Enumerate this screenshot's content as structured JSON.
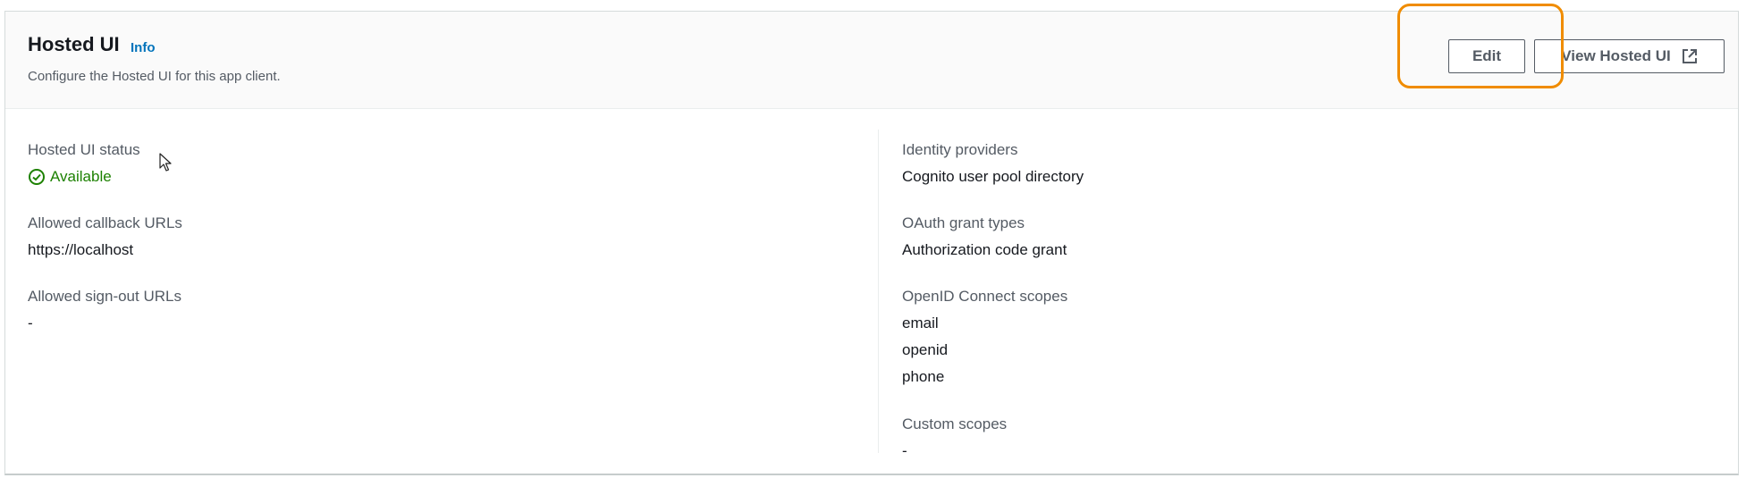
{
  "header": {
    "title": "Hosted UI",
    "info_label": "Info",
    "description": "Configure the Hosted UI for this app client."
  },
  "actions": {
    "edit_label": "Edit",
    "view_label": "View Hosted UI"
  },
  "left_column": {
    "status": {
      "label": "Hosted UI status",
      "value": "Available"
    },
    "callback_urls": {
      "label": "Allowed callback URLs",
      "value": "https://localhost"
    },
    "signout_urls": {
      "label": "Allowed sign-out URLs",
      "value": "-"
    }
  },
  "right_column": {
    "identity_providers": {
      "label": "Identity providers",
      "value": "Cognito user pool directory"
    },
    "grant_types": {
      "label": "OAuth grant types",
      "value": "Authorization code grant"
    },
    "oidc_scopes": {
      "label": "OpenID Connect scopes",
      "values": [
        "email",
        "openid",
        "phone"
      ]
    },
    "custom_scopes": {
      "label": "Custom scopes",
      "value": "-"
    }
  },
  "icons": {
    "status": "check-circle-icon",
    "external": "external-link-icon",
    "cursor": "mouse-pointer-icon"
  },
  "colors": {
    "link": "#0073bb",
    "success": "#1d8102",
    "highlight": "#f08c00"
  }
}
